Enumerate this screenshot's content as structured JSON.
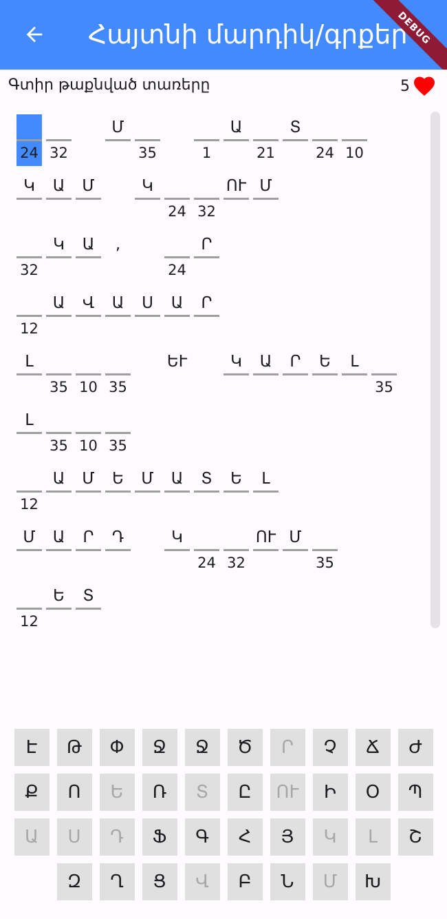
{
  "appbar": {
    "title": "Հայտնի մարդիկ/գրքեր",
    "back_label": "back",
    "debug_label": "DEBUG"
  },
  "subbar": {
    "hint": "Գտիր թաքնված տառերը",
    "lives": "5",
    "heart_color": "#ff0000"
  },
  "accent": "#448aff",
  "puzzle": {
    "lines": [
      [
        {
          "letter": "",
          "num": "24",
          "selected": true
        },
        {
          "letter": "",
          "num": "32"
        },
        {
          "space": true
        },
        {
          "letter": "Մ",
          "num": ""
        },
        {
          "letter": "",
          "num": "35"
        },
        {
          "space": true
        },
        {
          "letter": "",
          "num": "1"
        },
        {
          "letter": "Ա",
          "num": ""
        },
        {
          "letter": "",
          "num": "21"
        },
        {
          "letter": "Տ",
          "num": ""
        },
        {
          "letter": "",
          "num": "24"
        },
        {
          "letter": "",
          "num": "10"
        }
      ],
      [
        {
          "letter": "Կ",
          "num": ""
        },
        {
          "letter": "Ա",
          "num": ""
        },
        {
          "letter": "Մ",
          "num": ""
        },
        {
          "space": true
        },
        {
          "letter": "Կ",
          "num": ""
        },
        {
          "letter": "",
          "num": "24"
        },
        {
          "letter": "",
          "num": "32"
        },
        {
          "letter": "ՈՒ",
          "num": ""
        },
        {
          "letter": "Մ",
          "num": ""
        }
      ],
      [
        {
          "letter": "",
          "num": "32"
        },
        {
          "letter": "Կ",
          "num": ""
        },
        {
          "letter": "Ա",
          "num": ""
        },
        {
          "letter": ",",
          "num": "",
          "punct": true
        },
        {
          "space": true
        },
        {
          "letter": "",
          "num": "24"
        },
        {
          "letter": "Ր",
          "num": ""
        }
      ],
      [
        {
          "letter": "",
          "num": "12"
        },
        {
          "letter": "Ա",
          "num": ""
        },
        {
          "letter": "Վ",
          "num": ""
        },
        {
          "letter": "Ա",
          "num": ""
        },
        {
          "letter": "Ս",
          "num": ""
        },
        {
          "letter": "Ա",
          "num": ""
        },
        {
          "letter": "Ր",
          "num": ""
        }
      ],
      [
        {
          "letter": "Լ",
          "num": ""
        },
        {
          "letter": "",
          "num": "35"
        },
        {
          "letter": "",
          "num": "10"
        },
        {
          "letter": "",
          "num": "35"
        },
        {
          "space": true
        },
        {
          "letter": "ԵՒ",
          "num": "",
          "punct": true
        },
        {
          "space": true
        },
        {
          "letter": "Կ",
          "num": ""
        },
        {
          "letter": "Ա",
          "num": ""
        },
        {
          "letter": "Ր",
          "num": ""
        },
        {
          "letter": "Ե",
          "num": ""
        },
        {
          "letter": "Լ",
          "num": ""
        },
        {
          "letter": "",
          "num": "35"
        }
      ],
      [
        {
          "letter": "Լ",
          "num": ""
        },
        {
          "letter": "",
          "num": "35"
        },
        {
          "letter": "",
          "num": "10"
        },
        {
          "letter": "",
          "num": "35"
        }
      ],
      [
        {
          "letter": "",
          "num": "12"
        },
        {
          "letter": "Ա",
          "num": ""
        },
        {
          "letter": "Մ",
          "num": ""
        },
        {
          "letter": "Ե",
          "num": ""
        },
        {
          "letter": "Մ",
          "num": ""
        },
        {
          "letter": "Ա",
          "num": ""
        },
        {
          "letter": "Տ",
          "num": ""
        },
        {
          "letter": "Ե",
          "num": ""
        },
        {
          "letter": "Լ",
          "num": ""
        }
      ],
      [
        {
          "letter": "Մ",
          "num": ""
        },
        {
          "letter": "Ա",
          "num": ""
        },
        {
          "letter": "Ր",
          "num": ""
        },
        {
          "letter": "Դ",
          "num": ""
        },
        {
          "space": true
        },
        {
          "letter": "Կ",
          "num": ""
        },
        {
          "letter": "",
          "num": "24"
        },
        {
          "letter": "",
          "num": "32"
        },
        {
          "letter": "ՈՒ",
          "num": ""
        },
        {
          "letter": "Մ",
          "num": ""
        },
        {
          "letter": "",
          "num": "35"
        }
      ],
      [
        {
          "letter": "",
          "num": "12"
        },
        {
          "letter": "Ե",
          "num": ""
        },
        {
          "letter": "Տ",
          "num": ""
        }
      ]
    ]
  },
  "keyboard": {
    "rows": [
      [
        {
          "k": "Է"
        },
        {
          "k": "Թ"
        },
        {
          "k": "Փ"
        },
        {
          "k": "Ջ"
        },
        {
          "k": "Ջ"
        },
        {
          "k": "Ծ"
        },
        {
          "k": "Ր",
          "used": true
        },
        {
          "k": "Չ"
        },
        {
          "k": "Ճ"
        },
        {
          "k": "Ժ"
        }
      ],
      [
        {
          "k": "Ք"
        },
        {
          "k": "Ո"
        },
        {
          "k": "Ե",
          "used": true
        },
        {
          "k": "Ռ"
        },
        {
          "k": "Տ",
          "used": true
        },
        {
          "k": "Ը"
        },
        {
          "k": "ՈՒ",
          "used": true
        },
        {
          "k": "Ի"
        },
        {
          "k": "Օ"
        },
        {
          "k": "Պ"
        }
      ],
      [
        {
          "k": "Ա",
          "used": true
        },
        {
          "k": "Ս",
          "used": true
        },
        {
          "k": "Դ",
          "used": true
        },
        {
          "k": "Ֆ"
        },
        {
          "k": "Գ"
        },
        {
          "k": "Հ"
        },
        {
          "k": "Յ"
        },
        {
          "k": "Կ",
          "used": true
        },
        {
          "k": "Լ",
          "used": true
        },
        {
          "k": "Շ"
        }
      ],
      [
        {
          "k": "Զ"
        },
        {
          "k": "Ղ"
        },
        {
          "k": "Ց"
        },
        {
          "k": "Վ",
          "used": true
        },
        {
          "k": "Բ"
        },
        {
          "k": "Ն"
        },
        {
          "k": "Մ",
          "used": true
        },
        {
          "k": "Խ"
        }
      ]
    ]
  }
}
